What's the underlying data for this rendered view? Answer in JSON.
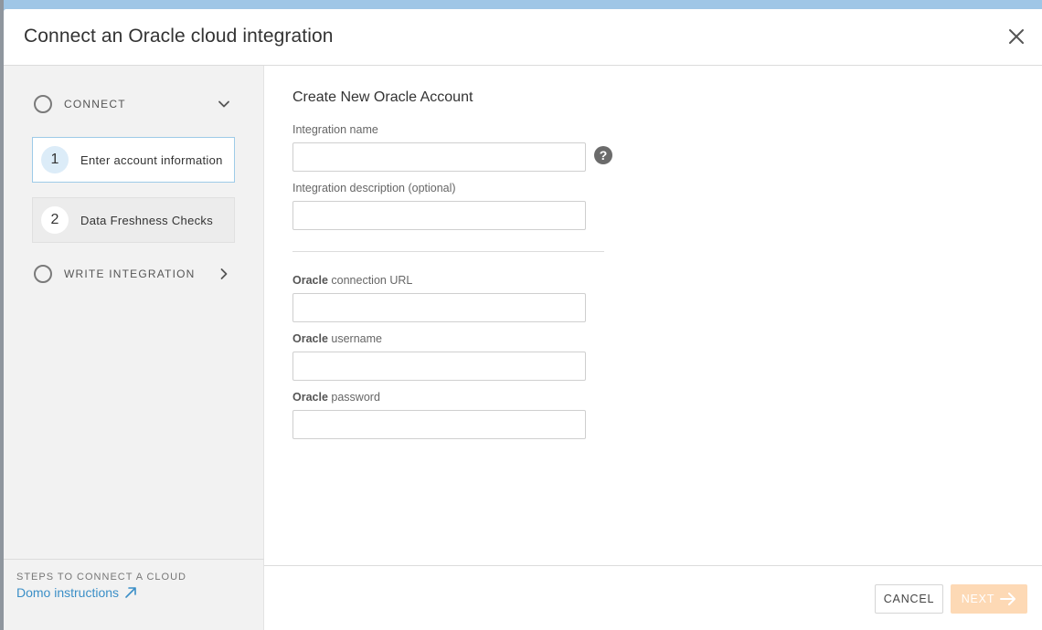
{
  "modal": {
    "title": "Connect an Oracle cloud integration"
  },
  "sidebar": {
    "sections": [
      {
        "label": "CONNECT",
        "state": "expanded"
      },
      {
        "label": "WRITE INTEGRATION",
        "state": "collapsed"
      }
    ],
    "steps": [
      {
        "number": "1",
        "label": "Enter account information",
        "active": true
      },
      {
        "number": "2",
        "label": "Data Freshness Checks",
        "active": false
      }
    ],
    "footer": {
      "caption": "STEPS TO CONNECT A CLOUD",
      "link_label": "Domo instructions"
    }
  },
  "form": {
    "title": "Create New Oracle Account",
    "fields": {
      "integration_name": {
        "label": "Integration name",
        "value": "",
        "placeholder": ""
      },
      "integration_description": {
        "label": "Integration description (optional)",
        "value": "",
        "placeholder": ""
      },
      "connection_url": {
        "label_bold": "Oracle",
        "label_rest": " connection URL",
        "value": "",
        "placeholder": ""
      },
      "username": {
        "label_bold": "Oracle",
        "label_rest": " username",
        "value": "",
        "placeholder": ""
      },
      "password": {
        "label_bold": "Oracle",
        "label_rest": " password",
        "value": "",
        "placeholder": ""
      }
    },
    "help_glyph": "?"
  },
  "footer": {
    "cancel_label": "CANCEL",
    "next_label": "NEXT"
  },
  "colors": {
    "accent_link": "#3b8fc7",
    "next_button_disabled": "#fdd9b5",
    "active_step_border": "#9ecbe8"
  },
  "icons": {
    "close": "close-icon",
    "expand": "chevron-down-icon",
    "collapsed": "chevron-right-icon",
    "help": "question-circle-icon",
    "external_link": "arrow-up-right-icon",
    "next": "arrow-right-icon"
  }
}
